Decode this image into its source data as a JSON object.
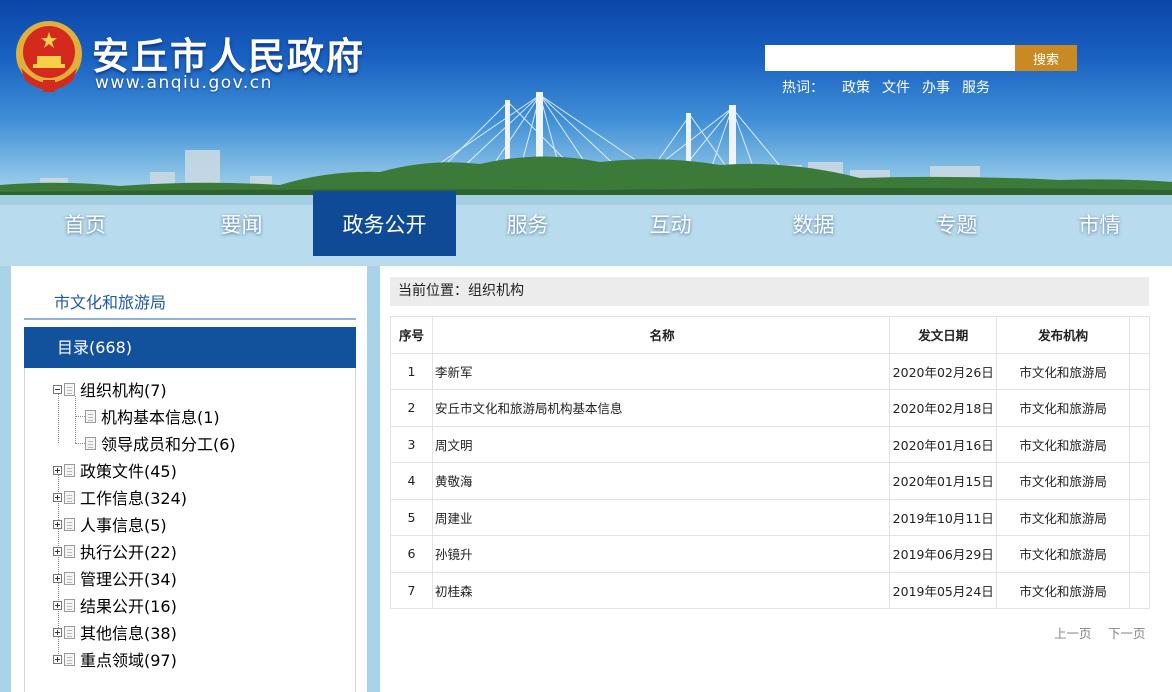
{
  "header": {
    "site_title": "安丘市人民政府",
    "site_url": "www.anqiu.gov.cn",
    "search": {
      "placeholder": "",
      "button_label": "搜索"
    },
    "hotwords_label": "热词：",
    "hotwords": [
      "政策",
      "文件",
      "办事",
      "服务"
    ]
  },
  "nav": {
    "items": [
      "首页",
      "要闻",
      "政务公开",
      "服务",
      "互动",
      "数据",
      "专题",
      "市情"
    ],
    "active_index": 2
  },
  "sidebar": {
    "department": "市文化和旅游局",
    "catalog_label": "目录(668)",
    "tree": [
      {
        "label": "组织机构(7)",
        "expanded": true,
        "children": [
          "机构基本信息(1)",
          "领导成员和分工(6)"
        ]
      },
      {
        "label": "政策文件(45)",
        "expanded": false
      },
      {
        "label": "工作信息(324)",
        "expanded": false
      },
      {
        "label": "人事信息(5)",
        "expanded": false
      },
      {
        "label": "执行公开(22)",
        "expanded": false
      },
      {
        "label": "管理公开(34)",
        "expanded": false
      },
      {
        "label": "结果公开(16)",
        "expanded": false
      },
      {
        "label": "其他信息(38)",
        "expanded": false
      },
      {
        "label": "重点领域(97)",
        "expanded": false
      }
    ]
  },
  "main": {
    "breadcrumb": "当前位置：组织机构",
    "table": {
      "headers": [
        "序号",
        "名称",
        "发文日期",
        "发布机构"
      ],
      "rows": [
        [
          "1",
          "李新军",
          "2020年02月26日",
          "市文化和旅游局"
        ],
        [
          "2",
          "安丘市文化和旅游局机构基本信息",
          "2020年02月18日",
          "市文化和旅游局"
        ],
        [
          "3",
          "周文明",
          "2020年01月16日",
          "市文化和旅游局"
        ],
        [
          "4",
          "黄敬海",
          "2020年01月15日",
          "市文化和旅游局"
        ],
        [
          "5",
          "周建业",
          "2019年10月11日",
          "市文化和旅游局"
        ],
        [
          "6",
          "孙镜升",
          "2019年06月29日",
          "市文化和旅游局"
        ],
        [
          "7",
          "初桂森",
          "2019年05月24日",
          "市文化和旅游局"
        ]
      ]
    },
    "pager": {
      "prev": "上一页",
      "next": "下一页"
    }
  },
  "colors": {
    "nav_active": "#0f4a97",
    "catalog_header": "#12519c",
    "search_button": "#c98a24",
    "dept_title": "#1f5aa6"
  },
  "icons": {
    "emblem": "national-emblem-icon",
    "tree_toggle": "tree-toggle-icon",
    "document": "document-icon"
  }
}
